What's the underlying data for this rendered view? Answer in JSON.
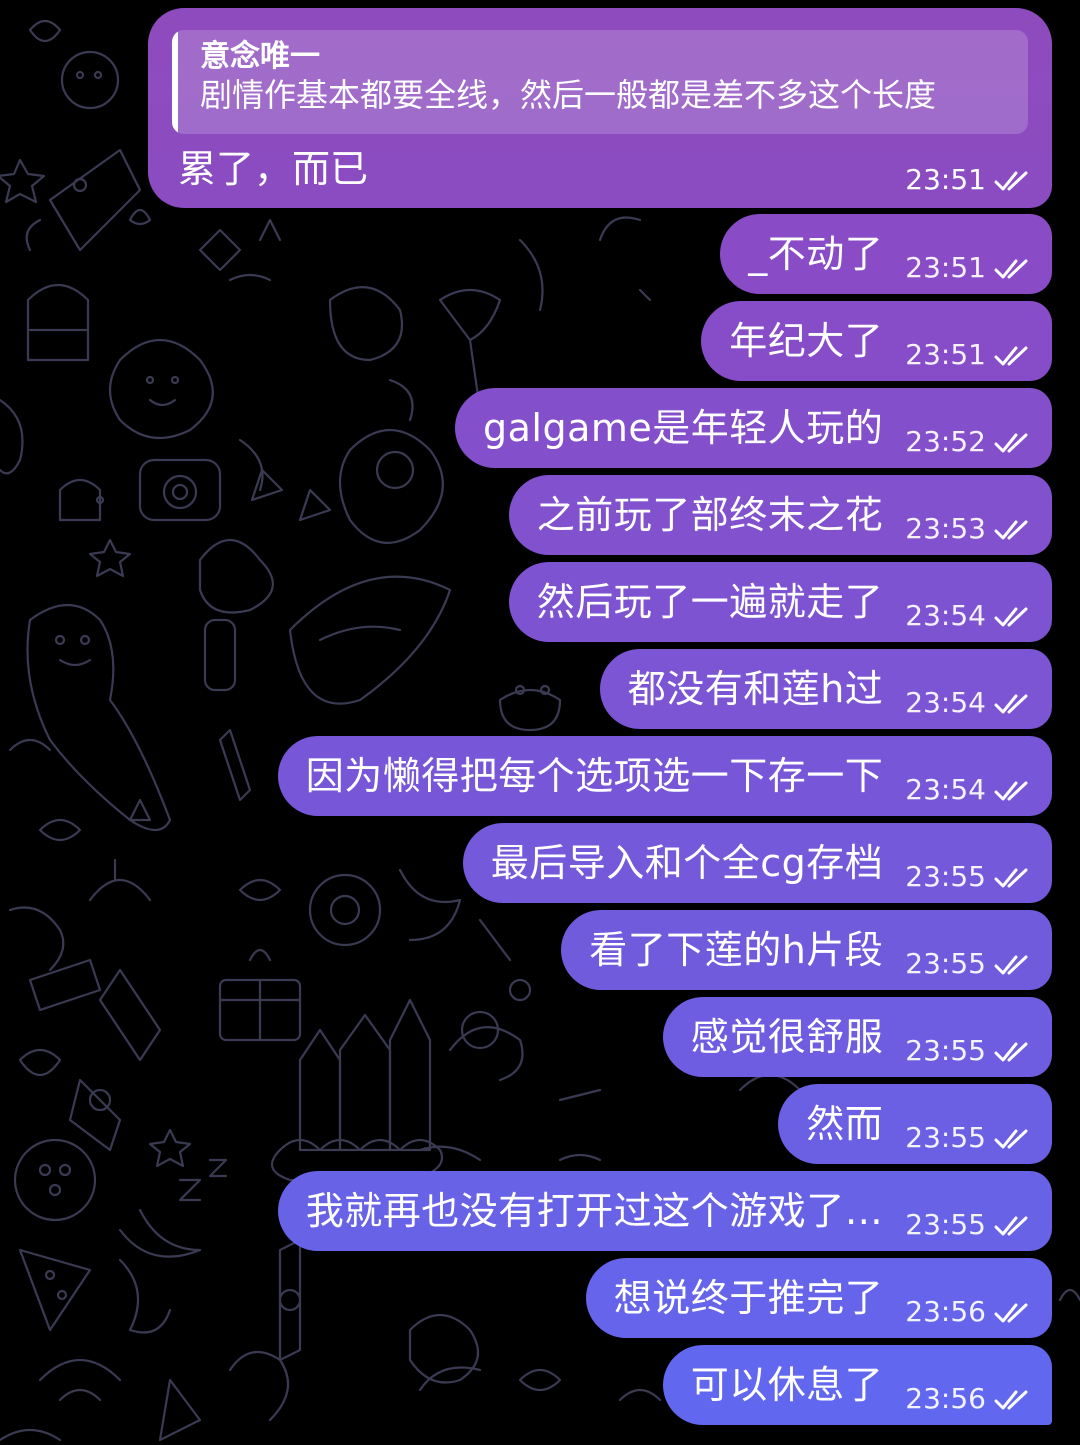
{
  "colors": {
    "background": "#000000",
    "doodle_stroke": "#3a3a52",
    "bubble_gradient_top": "#8e4bbd",
    "bubble_gradient_bottom": "#6167f2"
  },
  "reply_message": {
    "quote_author": "意念唯一",
    "quote_text": "剧情作基本都要全线，然后一般都是差不多这个长度",
    "text": "累了，而已",
    "time": "23:51",
    "status_icon": "double-check-icon"
  },
  "messages": [
    {
      "text": "_不动了",
      "time": "23:51",
      "color": "#8a4cc6"
    },
    {
      "text": "年纪大了",
      "time": "23:51",
      "color": "#874dc9"
    },
    {
      "text": "galgame是年轻人玩的",
      "time": "23:52",
      "color": "#844fcb"
    },
    {
      "text": "之前玩了部终末之花",
      "time": "23:53",
      "color": "#8151ce"
    },
    {
      "text": "然后玩了一遍就走了",
      "time": "23:54",
      "color": "#7e53d1"
    },
    {
      "text": "都没有和莲h过",
      "time": "23:54",
      "color": "#7b55d4"
    },
    {
      "text": "因为懒得把每个选项选一下存一下",
      "time": "23:54",
      "color": "#7757d7"
    },
    {
      "text": "最后导入和个全cg存档",
      "time": "23:55",
      "color": "#7459da"
    },
    {
      "text": "看了下莲的h片段",
      "time": "23:55",
      "color": "#715bdd"
    },
    {
      "text": "感觉很舒服",
      "time": "23:55",
      "color": "#6e5de0"
    },
    {
      "text": "然而",
      "time": "23:55",
      "color": "#6b5fe3"
    },
    {
      "text": "我就再也没有打开过这个游戏了…",
      "time": "23:55",
      "color": "#6862e7"
    },
    {
      "text": "想说终于推完了",
      "time": "23:56",
      "color": "#6564eb"
    },
    {
      "text": "可以休息了",
      "time": "23:56",
      "color": "#6267f0"
    }
  ]
}
